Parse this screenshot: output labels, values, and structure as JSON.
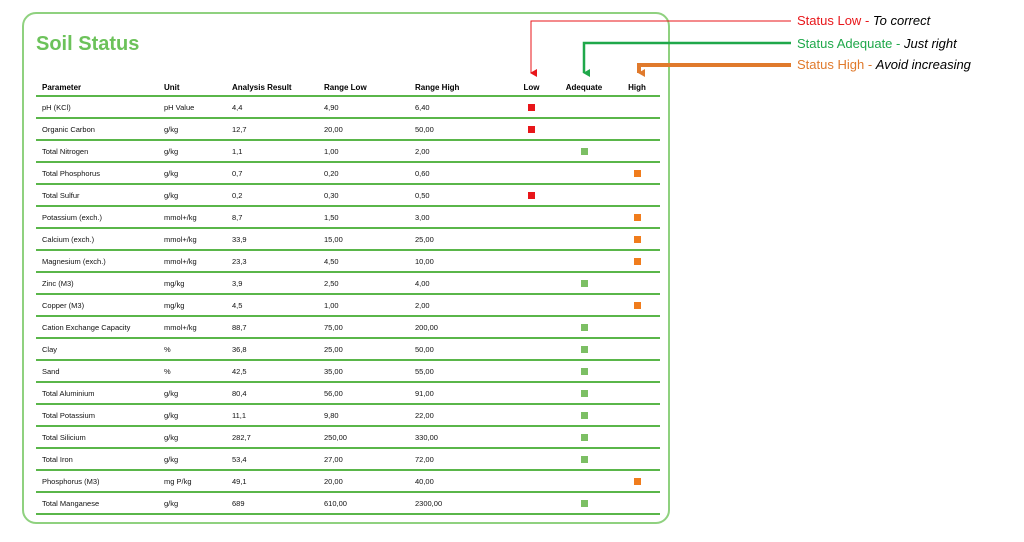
{
  "title": "Soil Status",
  "columns": [
    "Parameter",
    "Unit",
    "Analysis Result",
    "Range Low",
    "Range High",
    "Low",
    "Adequate",
    "High"
  ],
  "rows": [
    {
      "parameter": "pH (KCl)",
      "unit": "pH Value",
      "result": "4,4",
      "low": "4,90",
      "high": "6,40",
      "status": "low"
    },
    {
      "parameter": "Organic Carbon",
      "unit": "g/kg",
      "result": "12,7",
      "low": "20,00",
      "high": "50,00",
      "status": "low"
    },
    {
      "parameter": "Total Nitrogen",
      "unit": "g/kg",
      "result": "1,1",
      "low": "1,00",
      "high": "2,00",
      "status": "adequate"
    },
    {
      "parameter": "Total Phosphorus",
      "unit": "g/kg",
      "result": "0,7",
      "low": "0,20",
      "high": "0,60",
      "status": "high"
    },
    {
      "parameter": "Total Sulfur",
      "unit": "g/kg",
      "result": "0,2",
      "low": "0,30",
      "high": "0,50",
      "status": "low"
    },
    {
      "parameter": "Potassium (exch.)",
      "unit": "mmol+/kg",
      "result": "8,7",
      "low": "1,50",
      "high": "3,00",
      "status": "high"
    },
    {
      "parameter": "Calcium (exch.)",
      "unit": "mmol+/kg",
      "result": "33,9",
      "low": "15,00",
      "high": "25,00",
      "status": "high"
    },
    {
      "parameter": "Magnesium (exch.)",
      "unit": "mmol+/kg",
      "result": "23,3",
      "low": "4,50",
      "high": "10,00",
      "status": "high"
    },
    {
      "parameter": "Zinc (M3)",
      "unit": "mg/kg",
      "result": "3,9",
      "low": "2,50",
      "high": "4,00",
      "status": "adequate"
    },
    {
      "parameter": "Copper (M3)",
      "unit": "mg/kg",
      "result": "4,5",
      "low": "1,00",
      "high": "2,00",
      "status": "high"
    },
    {
      "parameter": "Cation Exchange Capacity",
      "unit": "mmol+/kg",
      "result": "88,7",
      "low": "75,00",
      "high": "200,00",
      "status": "adequate"
    },
    {
      "parameter": "Clay",
      "unit": "%",
      "result": "36,8",
      "low": "25,00",
      "high": "50,00",
      "status": "adequate"
    },
    {
      "parameter": "Sand",
      "unit": "%",
      "result": "42,5",
      "low": "35,00",
      "high": "55,00",
      "status": "adequate"
    },
    {
      "parameter": "Total Aluminium",
      "unit": "g/kg",
      "result": "80,4",
      "low": "56,00",
      "high": "91,00",
      "status": "adequate"
    },
    {
      "parameter": "Total Potassium",
      "unit": "g/kg",
      "result": "11,1",
      "low": "9,80",
      "high": "22,00",
      "status": "adequate"
    },
    {
      "parameter": "Total Silicium",
      "unit": "g/kg",
      "result": "282,7",
      "low": "250,00",
      "high": "330,00",
      "status": "adequate"
    },
    {
      "parameter": "Total Iron",
      "unit": "g/kg",
      "result": "53,4",
      "low": "27,00",
      "high": "72,00",
      "status": "adequate"
    },
    {
      "parameter": "Phosphorus (M3)",
      "unit": "mg P/kg",
      "result": "49,1",
      "low": "20,00",
      "high": "40,00",
      "status": "high"
    },
    {
      "parameter": "Total Manganese",
      "unit": "g/kg",
      "result": "689",
      "low": "610,00",
      "high": "2300,00",
      "status": "adequate"
    }
  ],
  "legend": {
    "low": {
      "label": "Status Low",
      "note": "To correct",
      "color": "#e8161a"
    },
    "adequate": {
      "label": "Status Adequate",
      "note": "Just right",
      "color": "#1fa84a"
    },
    "high": {
      "label": "Status High",
      "note": "Avoid increasing",
      "color": "#e07a2c"
    }
  },
  "colors": {
    "accent": "#6cc25a",
    "rule": "#5ab64a",
    "low_marker": "#e8161a",
    "adequate_marker": "#7cbf64",
    "high_marker": "#f07c1c"
  }
}
